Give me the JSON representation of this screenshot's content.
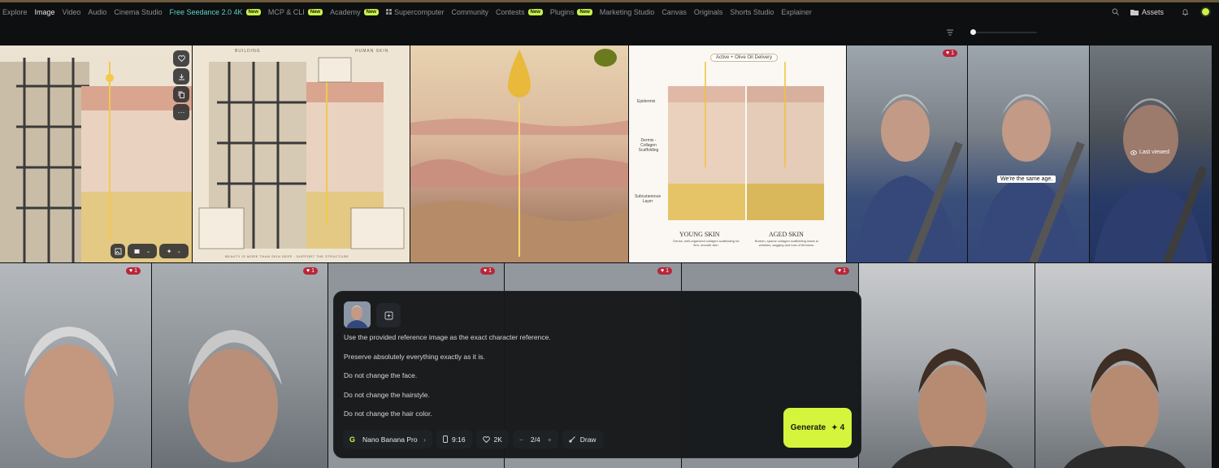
{
  "nav": {
    "items": [
      {
        "label": "Explore"
      },
      {
        "label": "Image",
        "active": true
      },
      {
        "label": "Video"
      },
      {
        "label": "Audio"
      },
      {
        "label": "Cinema Studio"
      },
      {
        "label": "Free Seedance 2.0 4K",
        "badge": "New",
        "promo": true
      },
      {
        "label": "MCP & CLI",
        "badge": "New"
      },
      {
        "label": "Academy",
        "badge": "New"
      },
      {
        "label": "Supercomputer",
        "icon": "grid-icon"
      },
      {
        "label": "Community"
      },
      {
        "label": "Contests",
        "badge": "New"
      },
      {
        "label": "Plugins",
        "badge": "New"
      },
      {
        "label": "Marketing Studio"
      },
      {
        "label": "Canvas"
      },
      {
        "label": "Originals"
      },
      {
        "label": "Shorts Studio"
      },
      {
        "label": "Explainer"
      }
    ],
    "assets_label": "Assets"
  },
  "gallery": {
    "row1": [
      {
        "kind": "building-skin"
      },
      {
        "kind": "infographic-building",
        "header_left": "BUILDING",
        "header_right": "HUMAN SKIN",
        "footer": "BEAUTY IS MORE THAN SKIN DEEP · SUPPORT THE STRUCTURE"
      },
      {
        "kind": "skin-oil"
      },
      {
        "kind": "skin-comparison",
        "badge": "Active + Olive Oil Delivery",
        "label_epidermis": "Epidermis",
        "label_dermis": "Dermis - Collagen Scaffolding",
        "label_sub": "Subcutaneous Layer",
        "young_title": "YOUNG SKIN",
        "young_desc": "Dense, well-organized collagen scaffolding for firm, smooth skin.",
        "aged_title": "AGED SKIN",
        "aged_desc": "Broken, sparse collagen scaffolding leads to wrinkles, sagging and loss of firmness."
      },
      {
        "kind": "man-car",
        "likes": "1"
      },
      {
        "kind": "man-car",
        "caption": "We're the same age."
      },
      {
        "kind": "man-car-dark",
        "last_viewed": "Last viewed"
      }
    ],
    "row2": [
      {
        "kind": "man-close",
        "likes": "1"
      },
      {
        "kind": "man-close",
        "likes": "1"
      },
      {
        "kind": "hidden",
        "likes": "1"
      },
      {
        "kind": "hidden",
        "likes": "1"
      },
      {
        "kind": "hidden",
        "likes": "1"
      },
      {
        "kind": "man-young"
      },
      {
        "kind": "man-young"
      }
    ]
  },
  "prompt_panel": {
    "lines": [
      "Use the provided reference image as the exact character reference.",
      "Preserve absolutely everything exactly as it is.",
      "Do not change the face.",
      "Do not change the hairstyle.",
      "Do not change the hair color."
    ],
    "model": "Nano Banana Pro",
    "aspect": "9:16",
    "quality": "2K",
    "count": "2/4",
    "draw": "Draw",
    "generate_label": "Generate",
    "generate_cost": "4"
  },
  "colors": {
    "accent": "#d4f53c",
    "like": "#b8263a",
    "promo": "#5fd3c9"
  }
}
